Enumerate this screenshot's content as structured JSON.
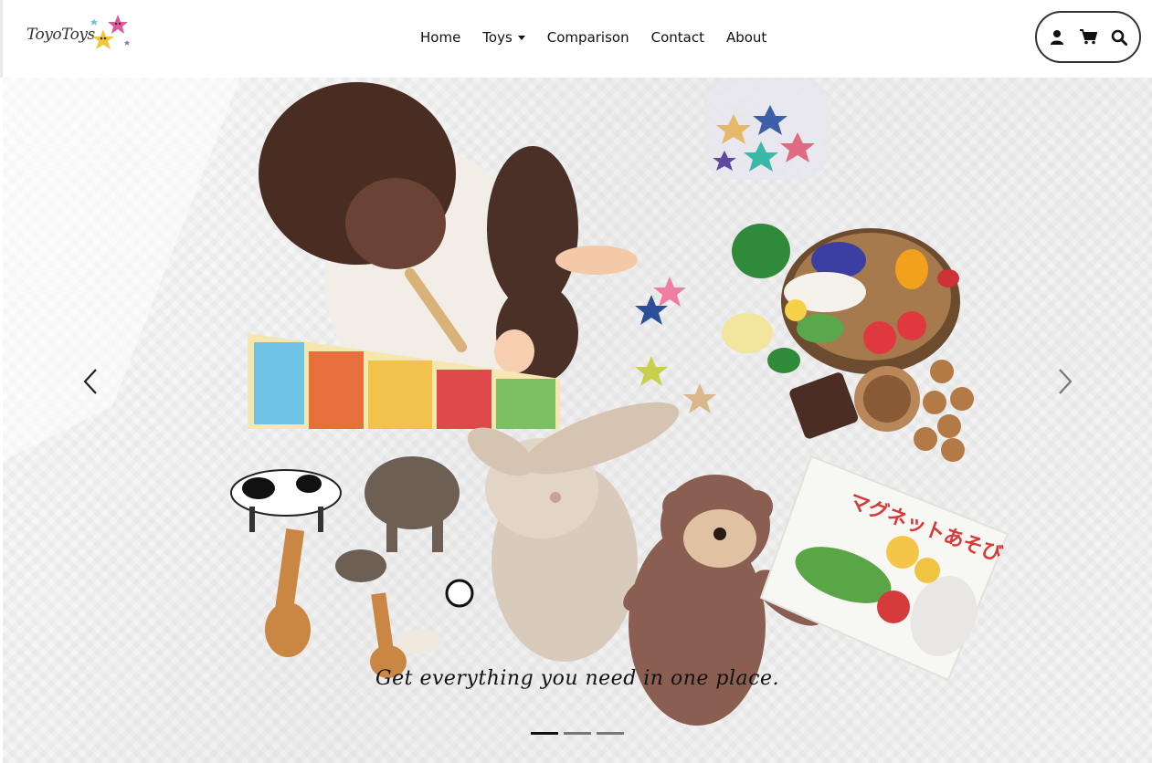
{
  "brand": {
    "name": "ToyoToys"
  },
  "nav": {
    "items": [
      {
        "label": "Home"
      },
      {
        "label": "Toys",
        "dropdown": true
      },
      {
        "label": "Comparison"
      },
      {
        "label": "Contact"
      },
      {
        "label": "About"
      }
    ]
  },
  "actions": {
    "icons": [
      "user-icon",
      "cart-icon",
      "search-icon"
    ]
  },
  "hero": {
    "caption": "Get everything you need in one place.",
    "slides": 3,
    "active_slide": 1,
    "book_text": "マグネットあそび"
  },
  "colors": {
    "star_pink": "#e0589a",
    "star_yellow": "#f2c737",
    "indicator_active": "#111111",
    "indicator_inactive": "#777777"
  }
}
